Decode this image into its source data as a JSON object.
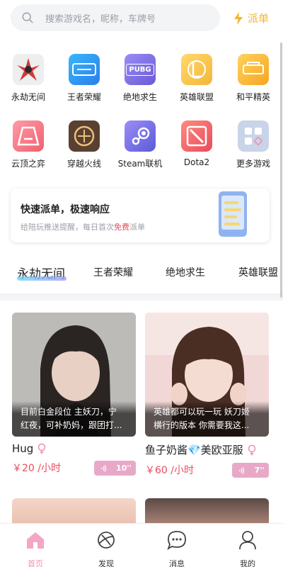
{
  "search": {
    "placeholder": "搜索游戏名，昵称，车牌号",
    "icon": "search-icon"
  },
  "dispatch": {
    "label": "派单",
    "icon": "lightning-icon",
    "color": "#f2b630"
  },
  "games": [
    {
      "label": "永劫无间",
      "icon": "naraka-icon"
    },
    {
      "label": "王者荣耀",
      "icon": "honor-of-kings-icon"
    },
    {
      "label": "绝地求生",
      "icon": "pubg-icon",
      "text": "PUBG"
    },
    {
      "label": "英雄联盟",
      "icon": "lol-icon"
    },
    {
      "label": "和平精英",
      "icon": "peacekeeper-icon"
    },
    {
      "label": "云顶之弈",
      "icon": "tft-icon"
    },
    {
      "label": "穿越火线",
      "icon": "crossfire-icon"
    },
    {
      "label": "Steam联机",
      "icon": "steam-icon"
    },
    {
      "label": "Dota2",
      "icon": "dota2-icon"
    },
    {
      "label": "更多游戏",
      "icon": "more-games-icon"
    }
  ],
  "banner": {
    "title": "快速派单，极速响应",
    "subtitle_pre": "给陪玩推送提醒，每日首次",
    "subtitle_highlight": "免费",
    "subtitle_post": "派单",
    "highlight_color": "#e94b5b"
  },
  "tabs": [
    {
      "label": "永劫无间",
      "active": true
    },
    {
      "label": "王者荣耀",
      "active": false
    },
    {
      "label": "绝地求生",
      "active": false
    },
    {
      "label": "英雄联盟",
      "active": false
    }
  ],
  "cards": [
    {
      "desc_line1": "目前白金段位 主妖刀，宁",
      "desc_line2": "红夜，可补奶妈，跟团打...",
      "name": "Hug",
      "price": "￥20 /小时",
      "voice_duration": "10''"
    },
    {
      "desc_line1": "英雄都可以玩一玩 妖刀姬",
      "desc_line2": "横行的版本 你需要我这...",
      "name": "鱼子奶酱💎美欧亚服",
      "price": "￥60 /小时",
      "voice_duration": "7''"
    }
  ],
  "nav": [
    {
      "label": "首页",
      "icon": "home-icon",
      "active": true
    },
    {
      "label": "发现",
      "icon": "planet-icon",
      "active": false
    },
    {
      "label": "消息",
      "icon": "message-icon",
      "active": false
    },
    {
      "label": "我的",
      "icon": "profile-icon",
      "active": false
    }
  ],
  "colors": {
    "accent_pink": "#f08fb0",
    "price_red": "#e94b5b",
    "voice_badge": "#e8a9c8"
  }
}
